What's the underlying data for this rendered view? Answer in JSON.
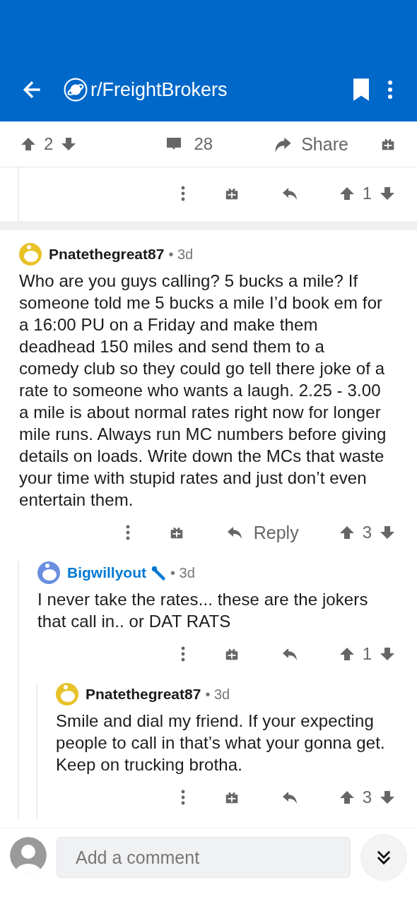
{
  "header": {
    "title": "r/FreightBrokers"
  },
  "post_bar": {
    "score": "2",
    "comments": "28",
    "share_label": "Share"
  },
  "partial_comment": {
    "score": "1"
  },
  "comments": [
    {
      "author": "Pnatethegreat87",
      "age": "• 3d",
      "color": "#e8c229",
      "highlighted": false,
      "body": "Who are you guys calling? 5 bucks a mile? If someone told me 5 bucks a mile I’d book em for a 16:00 PU on a Friday and make them deadhead 150 miles and send them to a comedy club so they could go tell there joke of a rate to someone who wants a laugh. 2.25 - 3.00 a mile is about normal rates right now for longer mile runs. Always run MC numbers before giving details on loads. Write down the MCs that waste your time with stupid rates and just don’t even entertain them.",
      "reply_label": "Reply",
      "score": "3",
      "children": [
        {
          "author": "Bigwillyout",
          "age": "• 3d",
          "color": "#6a8fe0",
          "highlighted": true,
          "body": "I never take the rates... these are the jokers that call in.. or DAT RATS",
          "score": "1",
          "children": [
            {
              "author": "Pnatethegreat87",
              "age": "• 3d",
              "color": "#e8c229",
              "highlighted": false,
              "body": "Smile and dial my friend. If your expecting people to call in that’s what your gonna get. Keep on trucking brotha.",
              "score": "3"
            }
          ]
        }
      ]
    }
  ],
  "composer": {
    "placeholder": "Add a comment"
  }
}
